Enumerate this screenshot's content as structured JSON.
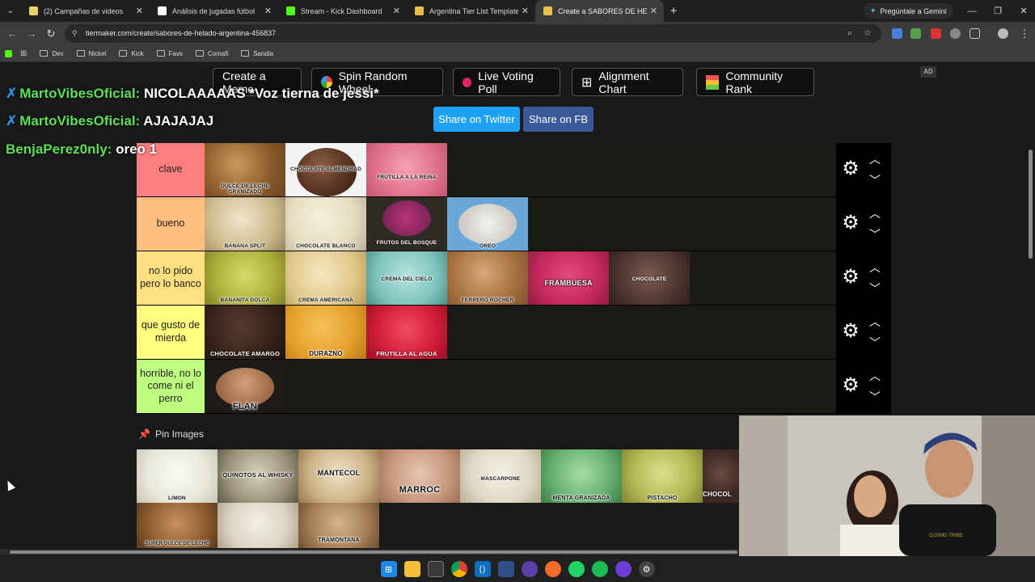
{
  "browser": {
    "tabs": [
      {
        "title": "(2) Campañas de videos",
        "favicon_color": "#e6d36b",
        "active": false
      },
      {
        "title": "Análisis de jugadas fútbol",
        "favicon_color": "#ffffff",
        "active": false
      },
      {
        "title": "Stream - Kick Dashboard",
        "favicon_color": "#53fc18",
        "active": false
      },
      {
        "title": "Argentina Tier List Templates -",
        "favicon_color": "#e8c14a",
        "active": false
      },
      {
        "title": "Create a SABORES DE HELADO",
        "favicon_color": "#e8c14a",
        "active": true
      }
    ],
    "gemini_label": "Pregúntale a Gemini",
    "url": "tiermaker.com/create/sabores-de-helado-argentina-456837",
    "bookmarks": [
      "Dev",
      "Nickel",
      "Kick",
      "Favs",
      "Comafi",
      "Sandia"
    ]
  },
  "toolbar": {
    "create_meme": "Create a Meme",
    "spin_wheel": "Spin Random Wheel",
    "voting_poll": "Live Voting Poll",
    "alignment_chart": "Alignment Chart",
    "community_rank": "Community Rank",
    "share_twitter": "Share on Twitter",
    "share_fb": "Share on FB",
    "ad_badge": "AD"
  },
  "chat": [
    {
      "user": "MartoVibesOficial:",
      "message": "NICOLAAAAAS *Voz tierna de jessi*"
    },
    {
      "user": "MartoVibesOficial:",
      "message": "AJAJAJAJ"
    },
    {
      "user": "BenjaPerez0nly:",
      "message": "oreo 1"
    }
  ],
  "tiers": [
    {
      "label": "clave",
      "color": "#ff7f7f",
      "items": [
        "DULCE DE LECHE GRANIZADO",
        "CHOCOLATE ALMENDRAD",
        "FRUTILLA A LA REINA"
      ]
    },
    {
      "label": "bueno",
      "color": "#ffbf7f",
      "items": [
        "BANANA SPLIT",
        "CHOCOLATE BLANCO",
        "FRUTOS DEL BOSQUE",
        "OREO"
      ]
    },
    {
      "label": "no lo pido pero lo banco",
      "color": "#ffdf7f",
      "items": [
        "BANANITA DOLCA",
        "CREMA AMERICANA",
        "CREMA DEL CIELO",
        "FERRERO ROCHER",
        "FRAMBUESA",
        "CHOCOLATE"
      ]
    },
    {
      "label": "que gusto de mierda",
      "color": "#ffff7f",
      "items": [
        "CHOCOLATE AMARGO",
        "DURAZNO",
        "FRUTILLA AL AGUA"
      ]
    },
    {
      "label": "horrible, no lo come ni el perro",
      "color": "#bfff7f",
      "items": [
        "FLAN"
      ]
    }
  ],
  "pin_images_label": "Pin Images",
  "pool": {
    "row1": [
      "LIMON",
      "QUINOTOS AL WHISKY",
      "MANTECOL",
      "MARROC",
      "MASCARPONE",
      "MENTA GRANIZADA",
      "PISTACHO",
      "CHOCOL"
    ],
    "row2": [
      "SUPER DULCE DE LECHE",
      "",
      "TRAMONTANA"
    ]
  },
  "webcam_brand": "COSMO TRIBE"
}
